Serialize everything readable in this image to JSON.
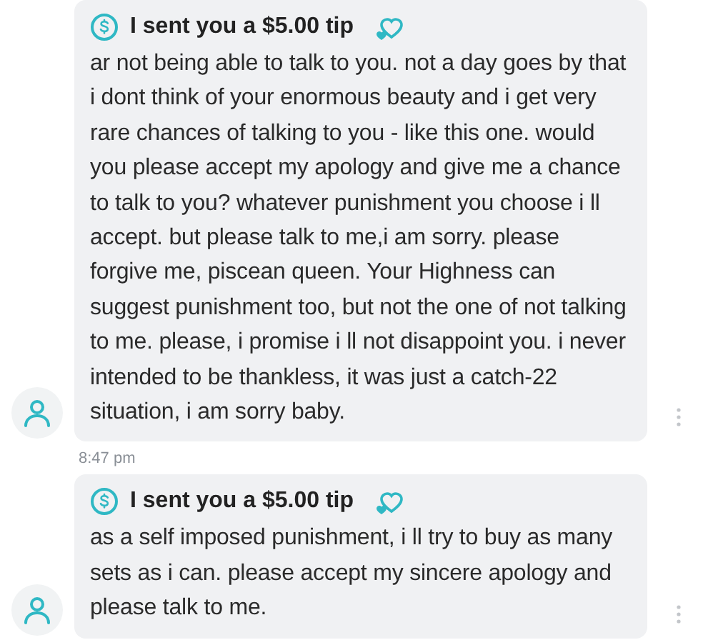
{
  "messages": [
    {
      "tip": "I sent you a $5.00 tip",
      "text": "ar not being able to talk to you. not a day goes by that i dont think of your enormous beauty and i get very rare chances of talking to you - like this one. would you please accept my apology and give me a chance to talk to you? whatever punishment you choose i ll accept. but please talk to me,i am sorry. please forgive me, piscean queen. Your Highness can suggest punishment too, but not the one of not talking to me. please, i promise i ll not disappoint you. i never intended to be thankless, it was just a catch-22 situation, i am sorry baby.",
      "time": "8:47 pm"
    },
    {
      "tip": "I sent you a $5.00 tip",
      "text": "as a self imposed punishment, i ll try to buy as many sets as i can. please accept my sincere apology and please talk to me."
    }
  ]
}
